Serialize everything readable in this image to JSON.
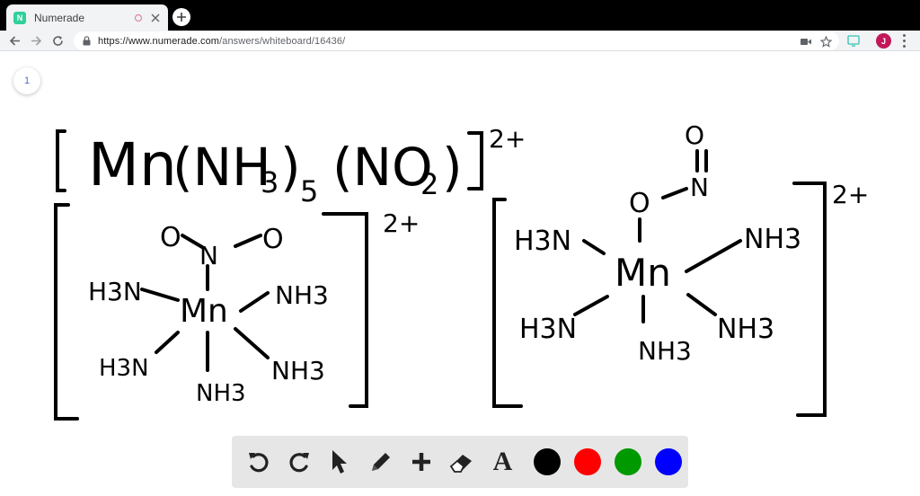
{
  "browser": {
    "tab_title": "Numerade",
    "favicon_letter": "N",
    "url_host": "https://www.numerade.com",
    "url_path": "/answers/whiteboard/16436/",
    "avatar_letter": "J"
  },
  "whiteboard": {
    "page_number": "1",
    "formula": {
      "open": "[",
      "metal": "Mn",
      "ligand1": "(NH",
      "sub1": "3",
      "close1": ")",
      "count1": "5",
      "ligand2": "(NO",
      "sub2": "2",
      "close2": ")",
      "close": "]",
      "charge": "2+"
    },
    "left_structure": {
      "charge": "2+",
      "metal": "Mn",
      "nitro_o1": "O",
      "nitro_n": "N",
      "nitro_o2": "O",
      "upper_left": "H3N",
      "upper_right": "NH3",
      "lower_left": "H3N",
      "lower_right": "NH3",
      "bottom": "NH3"
    },
    "right_structure": {
      "charge": "2+",
      "metal": "Mn",
      "nitrite_o_top": "O",
      "nitrite_n": "N",
      "nitrite_o_bound": "O",
      "upper_left": "H3N",
      "upper_right": "NH3",
      "lower_left": "H3N",
      "lower_right": "NH3",
      "bottom": "NH3"
    }
  },
  "palette": {
    "tools": [
      "undo-icon",
      "redo-icon",
      "pointer-icon",
      "pencil-icon",
      "add-icon",
      "eraser-icon",
      "text-icon"
    ],
    "text_tool_glyph": "A",
    "colors": [
      "#000000",
      "#ff0000",
      "#009900",
      "#0000ff"
    ]
  }
}
